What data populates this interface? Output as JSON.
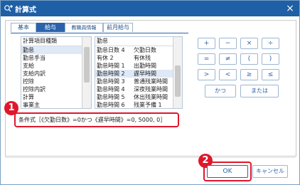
{
  "window": {
    "title": "計算式",
    "close": "×"
  },
  "tabs": [
    {
      "label": "基本",
      "active": false
    },
    {
      "label": "給与",
      "active": true
    },
    {
      "label": "教職員情報",
      "active": false
    },
    {
      "label": "前月給与",
      "active": false
    }
  ],
  "left_list": {
    "header": "計算項目種類",
    "items": [
      "勤怠",
      "勤怠手当",
      "支給",
      "支給内訳",
      "控除",
      "控除内訳",
      "計算",
      "事業主"
    ],
    "selected_index": 0
  },
  "right_list": {
    "header": "勤怠",
    "items": [
      [
        "勤怠日数 4",
        "欠勤日数"
      ],
      [
        "有休 2",
        "有休残"
      ],
      [
        "勤怠時間 1",
        "出勤時間"
      ],
      [
        "勤怠時間 2",
        "遅早時間"
      ],
      [
        "勤怠時間 3",
        "普通残業時間"
      ],
      [
        "勤怠時間 4",
        "深夜残業時間"
      ],
      [
        "勤怠時間 5",
        "休出残業時間"
      ],
      [
        "勤怠時間 6",
        "残業予備 1"
      ]
    ],
    "selected_index": 3
  },
  "operators": [
    "+",
    "−",
    "×",
    "÷",
    "=",
    "≠",
    "(",
    ")",
    ">",
    "<",
    "≥",
    "≤"
  ],
  "logic_buttons": {
    "and": "かつ",
    "or": "または"
  },
  "expression": "条件式［《欠勤日数》=0かつ《遅早時間》=0, 5000, 0］",
  "badges": {
    "one": "1",
    "two": "2"
  },
  "buttons": {
    "ok": "OK",
    "cancel": "キャンセル"
  },
  "colors": {
    "titlebar": "#1f5fa5",
    "accent": "#2a63ab",
    "highlight": "#e0172b"
  }
}
